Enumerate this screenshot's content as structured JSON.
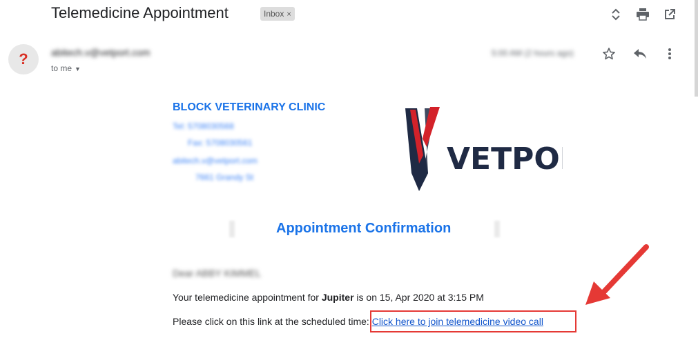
{
  "email": {
    "subject": "Telemedicine Appointment",
    "label_chip": "Inbox",
    "label_chip_close": "×",
    "sender": "abitech.v@vetport.com",
    "recipient": "to me",
    "timestamp": "5:00 AM (2 hours ago)"
  },
  "icons": {
    "expand": "expand-collapse-icon",
    "print": "print-icon",
    "open_new_window": "open-in-new-window-icon",
    "avatar": "unknown-sender-icon",
    "star": "star-icon",
    "reply": "reply-icon",
    "more": "more-vert-icon"
  },
  "clinic": {
    "name": "BLOCK VETERINARY CLINIC",
    "tel": "Tel: 5708030568",
    "fax": "Fax: 5708030561",
    "email": "abitech.v@vetport.com",
    "address": "7661 Grandy St"
  },
  "logo": {
    "text": "VETPORT"
  },
  "content": {
    "title": "Appointment Confirmation",
    "greeting": "Dear ABBY KIMMEL",
    "line1_prefix": "Your telemedicine appointment for ",
    "pet_name": "Jupiter",
    "line1_suffix": " is on 15, Apr 2020 at 3:15 PM",
    "line2_prefix": "Please click on this link at the scheduled time: ",
    "link_text": "Click here to join telemedicine video call"
  },
  "colors": {
    "accent_blue": "#1a73e8",
    "link_blue": "#1155cc",
    "annotation_red": "#e53935",
    "logo_navy": "#1f2a44",
    "logo_red": "#d3222a"
  }
}
